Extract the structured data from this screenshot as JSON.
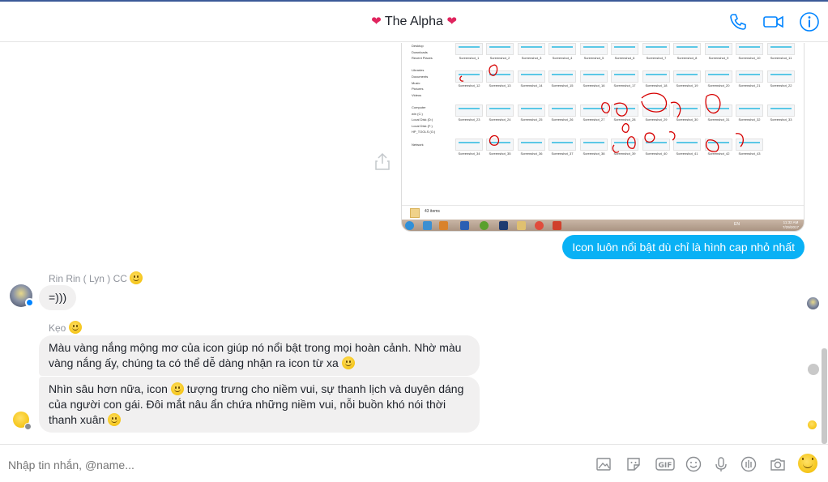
{
  "header": {
    "title": "The Alpha",
    "heart_icon": "red-heart-icon",
    "actions": [
      {
        "name": "phone-icon"
      },
      {
        "name": "video-camera-icon"
      },
      {
        "name": "info-icon"
      }
    ]
  },
  "shared_image": {
    "sidebar": [
      "Desktop",
      "Downloads",
      "Recent Places",
      "",
      "Libraries",
      "Documents",
      "Music",
      "Pictures",
      "Videos",
      "",
      "Computer",
      "win (C:)",
      "Local Disk (D:)",
      "Local Disk (F:)",
      "HP_TOOLS (G:)",
      "",
      "Network"
    ],
    "thumbnails": [
      "Screenshot_1",
      "Screenshot_2",
      "Screenshot_3",
      "Screenshot_4",
      "Screenshot_5",
      "Screenshot_6",
      "Screenshot_7",
      "Screenshot_8",
      "Screenshot_9",
      "Screenshot_10",
      "Screenshot_11",
      "Screenshot_12",
      "Screenshot_13",
      "Screenshot_14",
      "Screenshot_15",
      "Screenshot_16",
      "Screenshot_17",
      "Screenshot_18",
      "Screenshot_19",
      "Screenshot_20",
      "Screenshot_21",
      "Screenshot_22",
      "Screenshot_23",
      "Screenshot_24",
      "Screenshot_25",
      "Screenshot_26",
      "Screenshot_27",
      "Screenshot_28",
      "Screenshot_29",
      "Screenshot_30",
      "Screenshot_31",
      "Screenshot_32",
      "Screenshot_33",
      "Screenshot_34",
      "Screenshot_35",
      "Screenshot_36",
      "Screenshot_37",
      "Screenshot_38",
      "Screenshot_39",
      "Screenshot_40",
      "Screenshot_41",
      "Screenshot_42",
      "Screenshot_43"
    ],
    "item_count": "43 items",
    "tray_lang": "EN",
    "tray_time": "11:32 AM",
    "tray_date": "7/29/2017"
  },
  "messages": {
    "mine_1": "Icon luôn nổi bật dù chỉ là hình cap nhỏ nhất",
    "sender_1": "Rin Rin ( Lyn ) CC",
    "msg_1": "=)))",
    "sender_2": "Kẹo",
    "msg_2": "Màu vàng nắng mộng mơ của icon giúp nó nổi bật trong mọi hoàn cảnh. Nhờ màu vàng nắng ấy, chúng ta có thể dễ dàng nhận ra icon từ xa",
    "msg_3_a": "Nhìn sâu hơn nữa, icon",
    "msg_3_b": "tượng trưng cho niềm vui, sự thanh lịch và duyên dáng của người con gái. Đôi mắt nâu ẩn chứa những niềm vui, nỗi buồn khó nói thời thanh xuân"
  },
  "composer": {
    "placeholder": "Nhập tin nhắn, @name...",
    "icons": [
      "image-icon",
      "sticker-icon",
      "gif-icon",
      "emoji-icon",
      "microphone-icon",
      "audio-icon",
      "camera-icon",
      "like-emoji-icon"
    ]
  },
  "colors": {
    "accent": "#0084ff",
    "my_bubble": "#09b1f5",
    "their_bubble": "#f1f0f0",
    "heart": "#e0245e"
  }
}
